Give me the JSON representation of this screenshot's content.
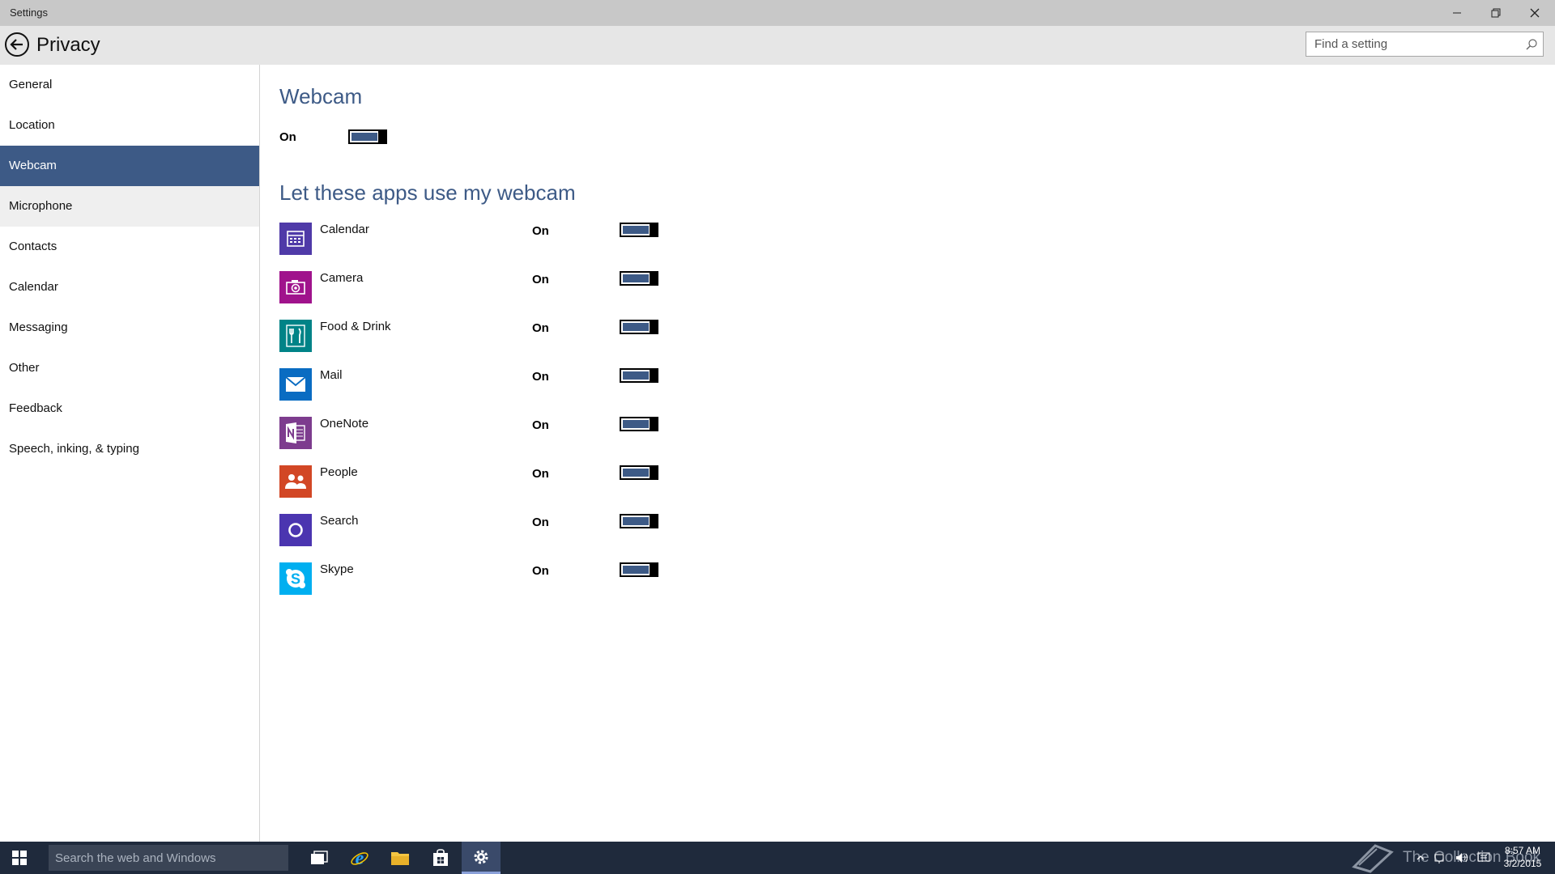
{
  "window": {
    "title": "Settings"
  },
  "header": {
    "title": "Privacy",
    "search_placeholder": "Find a setting"
  },
  "sidebar": {
    "items": [
      {
        "label": "General"
      },
      {
        "label": "Location"
      },
      {
        "label": "Webcam",
        "selected": true
      },
      {
        "label": "Microphone"
      },
      {
        "label": "Contacts"
      },
      {
        "label": "Calendar"
      },
      {
        "label": "Messaging"
      },
      {
        "label": "Other"
      },
      {
        "label": "Feedback"
      },
      {
        "label": "Speech, inking, & typing"
      }
    ]
  },
  "main": {
    "title": "Webcam",
    "toggle_label": "On",
    "toggle_on": true,
    "apps_title": "Let these apps use my webcam",
    "apps": [
      {
        "name": "Calendar",
        "state": "On",
        "icon": "calendar-icon",
        "color": "#4f3aa8"
      },
      {
        "name": "Camera",
        "state": "On",
        "icon": "camera-icon",
        "color": "#a0138c"
      },
      {
        "name": "Food & Drink",
        "state": "On",
        "icon": "food-drink-icon",
        "color": "#008387"
      },
      {
        "name": "Mail",
        "state": "On",
        "icon": "mail-icon",
        "color": "#0a6cc2"
      },
      {
        "name": "OneNote",
        "state": "On",
        "icon": "onenote-icon",
        "color": "#7d3c8e"
      },
      {
        "name": "People",
        "state": "On",
        "icon": "people-icon",
        "color": "#d24725"
      },
      {
        "name": "Search",
        "state": "On",
        "icon": "search-app-icon",
        "color": "#4b35b0"
      },
      {
        "name": "Skype",
        "state": "On",
        "icon": "skype-icon",
        "color": "#00aff0"
      }
    ]
  },
  "taskbar": {
    "search_placeholder": "Search the web and Windows",
    "time": "8:57 AM",
    "date": "3/2/2015",
    "watermark": "The Collection Book"
  },
  "colors": {
    "accent": "#3d5a86",
    "titlebar": "#c8c8c8",
    "header": "#e6e6e6",
    "taskbar": "#1f2a3c"
  }
}
